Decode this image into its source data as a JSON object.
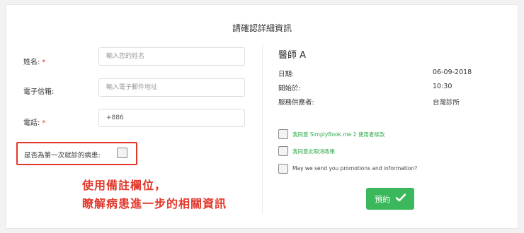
{
  "page_title": "請確認詳細資訊",
  "form": {
    "name_label": "姓名:",
    "name_required": "*",
    "name_placeholder": "輸入您的姓名",
    "email_label": "電子信箱:",
    "email_placeholder": "輸入電子郵件地址",
    "phone_label": "電話:",
    "phone_required": "*",
    "phone_value": "+886",
    "first_visit_label": "是否為第一次就診的病患:"
  },
  "booking": {
    "doctor": "醫師 A",
    "date_label": "日期:",
    "date_value": "06-09-2018",
    "start_label": "開始於:",
    "start_value": "10:30",
    "provider_label": "服務供應者:",
    "provider_value": "台灣診所",
    "checkbox_terms": "我同意 SimplyBook.me 2 使用者條款",
    "checkbox_cancel": "我同意此取消政策",
    "checkbox_promo": "May we send you promotions and information?",
    "submit_label": "預約"
  },
  "annotation": {
    "line1": "使用備註欄位，",
    "line2": "瞭解病患進一步的相關資訊"
  },
  "colors": {
    "accent_green": "#3cb85c",
    "highlight_red": "#e2382c"
  }
}
